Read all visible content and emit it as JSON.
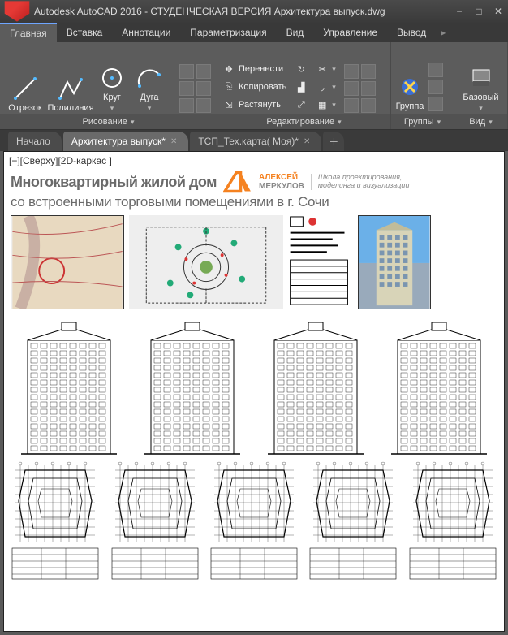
{
  "title": "Autodesk AutoCAD 2016 - СТУДЕНЧЕСКАЯ ВЕРСИЯ   Архитектура выпуск.dwg",
  "menu": {
    "items": [
      "Главная",
      "Вставка",
      "Аннотации",
      "Параметризация",
      "Вид",
      "Управление",
      "Вывод"
    ],
    "active": 0
  },
  "ribbon": {
    "draw": {
      "title": "Рисование",
      "line": "Отрезок",
      "polyline": "Полилиния",
      "circle": "Круг",
      "arc": "Дуга"
    },
    "edit": {
      "title": "Редактирование",
      "move": "Перенести",
      "copy": "Копировать",
      "stretch": "Растянуть"
    },
    "groups": {
      "title": "Группы",
      "group": "Группа"
    },
    "view": {
      "title": "Вид",
      "base": "Базовый"
    }
  },
  "tabs": {
    "items": [
      "Начало",
      "Архитектура выпуск*",
      "ТСП_Тех.карта( Моя)*"
    ],
    "active": 1
  },
  "canvas": {
    "view_label": "[−][Сверху][2D-каркас ]",
    "project_title": "Многоквартирный жилой дом",
    "project_sub": "со встроенными торговыми помещениями в г. Сочи",
    "brand_first": "АЛЕКСЕЙ",
    "brand_last": "МЕРКУЛОВ",
    "tagline1": "Школа проектирования,",
    "tagline2": "моделинга и визуализации"
  }
}
